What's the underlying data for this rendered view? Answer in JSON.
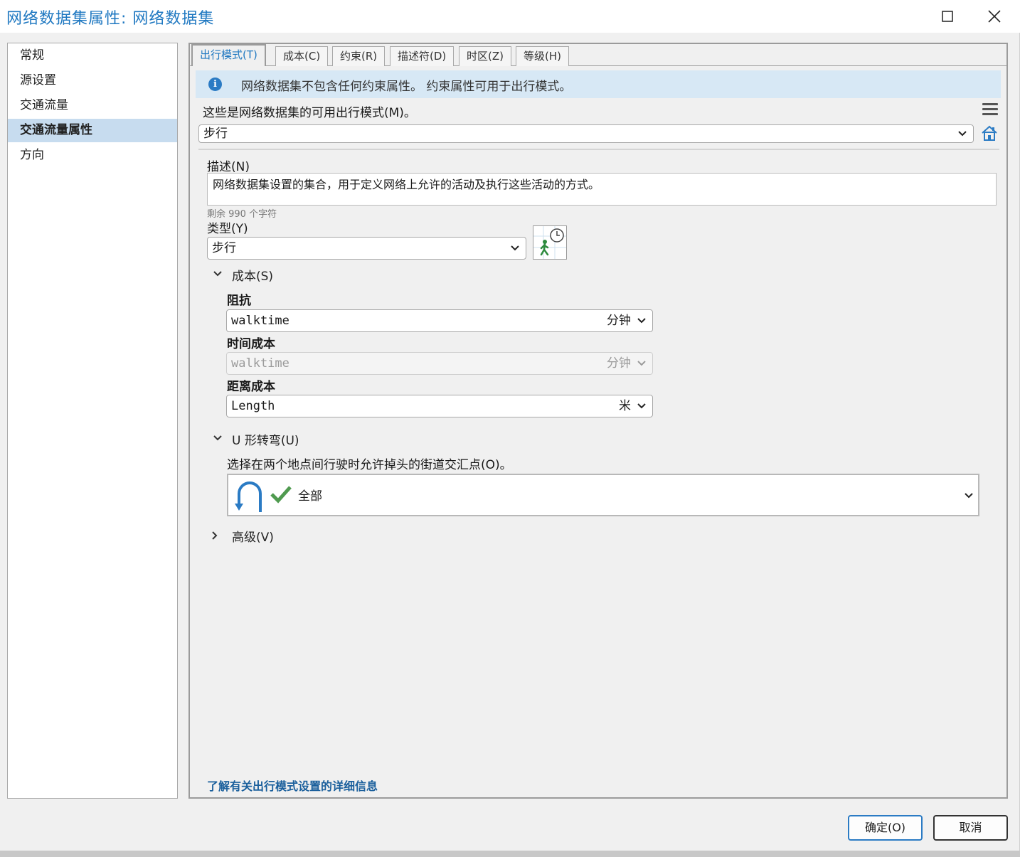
{
  "window": {
    "title": "网络数据集属性: 网络数据集"
  },
  "nav": {
    "items": [
      {
        "label": "常规"
      },
      {
        "label": "源设置"
      },
      {
        "label": "交通流量"
      },
      {
        "label": "交通流量属性"
      },
      {
        "label": "方向"
      }
    ],
    "selected": "交通流量属性"
  },
  "tabs": [
    {
      "label": "出行模式(T)"
    },
    {
      "label": "成本(C)"
    },
    {
      "label": "约束(R)"
    },
    {
      "label": "描述符(D)"
    },
    {
      "label": "时区(Z)"
    },
    {
      "label": "等级(H)"
    }
  ],
  "info": {
    "message": "网络数据集不包含任何约束属性。 约束属性可用于出行模式。"
  },
  "travel_modes": {
    "label": "这些是网络数据集的可用出行模式(M)。",
    "selected": "步行"
  },
  "description": {
    "label": "描述(N)",
    "value": "网络数据集设置的集合，用于定义网络上允许的活动及执行这些活动的方式。",
    "remaining": "剩余 990 个字符"
  },
  "type": {
    "label": "类型(Y)",
    "value": "步行"
  },
  "costs": {
    "header": "成本(S)",
    "impedance": {
      "label": "阻抗",
      "value": "walktime",
      "unit": "分钟"
    },
    "time_cost": {
      "label": "时间成本",
      "value": "walktime",
      "unit": "分钟"
    },
    "distance_cost": {
      "label": "距离成本",
      "value": "Length",
      "unit": "米"
    }
  },
  "uturn": {
    "header": "U 形转弯(U)",
    "prompt": "选择在两个地点间行驶时允许掉头的街道交汇点(O)。",
    "value": "全部"
  },
  "advanced": {
    "header": "高级(V)"
  },
  "link": {
    "text": "了解有关出行模式设置的详细信息"
  },
  "buttons": {
    "ok": "确定(O)",
    "cancel": "取消"
  },
  "colors": {
    "accent": "#1f78c1",
    "selected_nav": "#c7dcef",
    "info_bar": "#d7e8f5",
    "walker_green": "#2e8b3d"
  }
}
